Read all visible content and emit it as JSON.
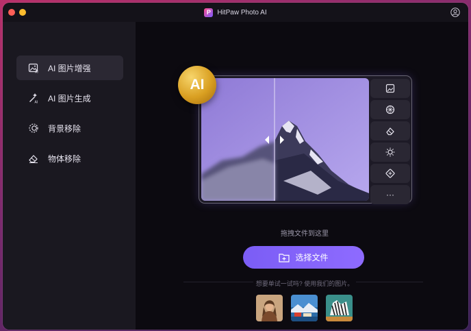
{
  "window": {
    "title": "HitPaw Photo AI"
  },
  "sidebar": {
    "items": [
      {
        "label": "AI 图片增强",
        "icon": "image-sparkle-icon",
        "active": true
      },
      {
        "label": "AI 图片生成",
        "icon": "magic-wand-icon",
        "active": false
      },
      {
        "label": "背景移除",
        "icon": "background-remove-icon",
        "active": false
      },
      {
        "label": "物体移除",
        "icon": "eraser-icon",
        "active": false
      }
    ]
  },
  "preview": {
    "badge": "AI",
    "tools": [
      "image-icon",
      "circle-pattern-icon",
      "eraser-icon",
      "brightness-icon",
      "resize-icon",
      "more-icon"
    ],
    "more_label": "···"
  },
  "main": {
    "drop_hint": "拖拽文件到这里",
    "select_button": "选择文件",
    "sample_hint": "想要单试一试吗? 使用我们的图片。"
  },
  "samples": [
    "portrait-thumbnail",
    "landscape-thumbnail",
    "zebra-thumbnail"
  ],
  "colors": {
    "accent": "#7b5df5",
    "badge_gold": "#d99f21",
    "window_bg": "#0d0b12",
    "sidebar_bg": "#1a1820"
  }
}
